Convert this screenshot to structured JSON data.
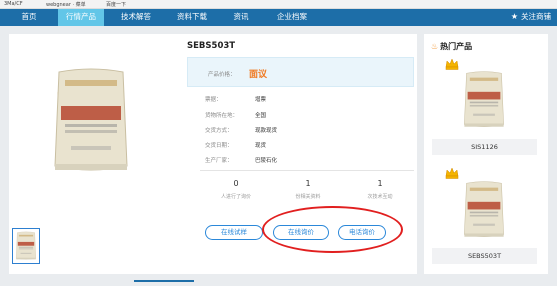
{
  "topbar": {
    "items": [
      "3Ma/CF",
      "webgnear · 菜单",
      "百度一下"
    ]
  },
  "nav": {
    "items": [
      "首页",
      "行情产品",
      "技术解答",
      "资料下载",
      "资讯",
      "企业档案"
    ],
    "follow": "关注商铺"
  },
  "product": {
    "title": "SEBS503T",
    "price_label": "产品价格：",
    "price_value": "面议",
    "attributes": [
      {
        "key": "票据：",
        "value": "增票"
      },
      {
        "key": "货物所在地：",
        "value": "全国"
      },
      {
        "key": "交货方式：",
        "value": "现款现货"
      },
      {
        "key": "交货日期：",
        "value": "现货"
      },
      {
        "key": "生产厂家：",
        "value": "巴陵石化"
      }
    ],
    "stats": [
      {
        "num": "0",
        "label": "人进行了询价"
      },
      {
        "num": "1",
        "label": "份相关资料"
      },
      {
        "num": "1",
        "label": "次技术互动"
      }
    ],
    "buttons": [
      "在线试样",
      "在线询价",
      "电话询价"
    ]
  },
  "sidebar": {
    "title": "热门产品",
    "products": [
      "SIS1126",
      "SEBS503T"
    ]
  },
  "bag_text": "热塑性弹性体",
  "colors": {
    "nav_bg": "#1d6ea8",
    "nav_active": "#62c6e8",
    "price": "#f07a22",
    "button": "#2b88d9",
    "highlight_circle": "#e11f1f"
  }
}
